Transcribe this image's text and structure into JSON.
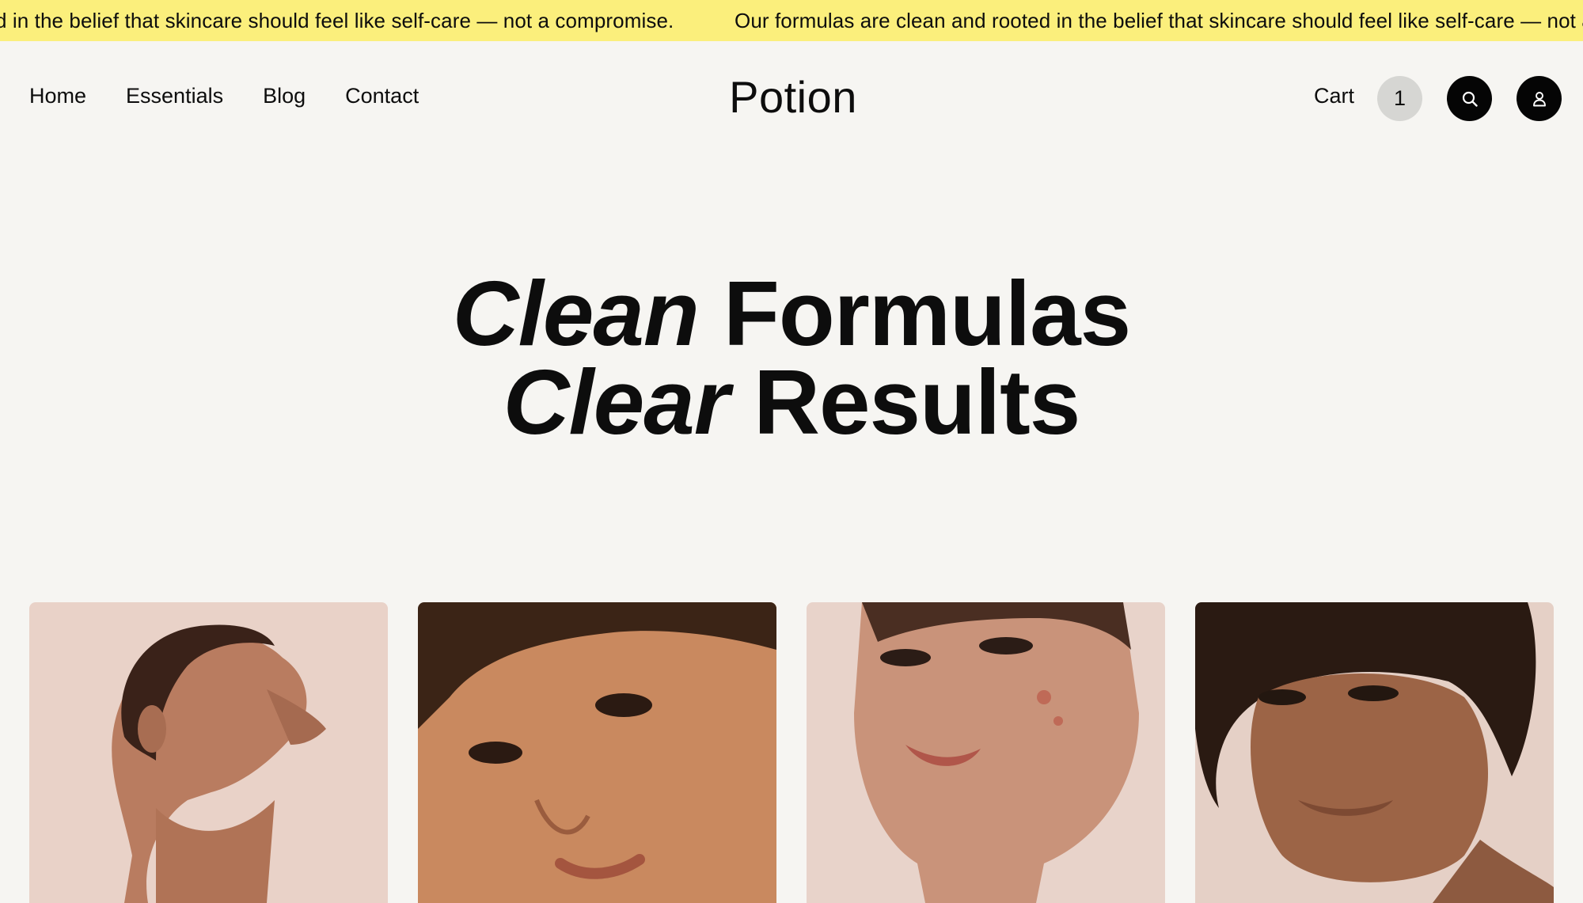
{
  "announcement": {
    "fragment_start": "d in the belief that skincare should feel like self-care — not a compromise.",
    "fragment_end": "Our formulas are clean and rooted in the belief that skincare should feel like self-care — not a c"
  },
  "nav": {
    "items": [
      {
        "label": "Home"
      },
      {
        "label": "Essentials"
      },
      {
        "label": "Blog"
      },
      {
        "label": "Contact"
      }
    ]
  },
  "brand": {
    "name": "Potion"
  },
  "actions": {
    "cart_label": "Cart",
    "cart_count": "1",
    "search_icon": "search-icon",
    "account_icon": "user-icon"
  },
  "hero": {
    "line1_italic": "Clean",
    "line1_rest": "Formulas",
    "line2_italic": "Clear",
    "line2_rest": "Results"
  },
  "gallery": {
    "images": [
      {
        "name": "portrait-woman-profile"
      },
      {
        "name": "portrait-closeup-freckles"
      },
      {
        "name": "portrait-man-acne"
      },
      {
        "name": "portrait-man-freckles"
      }
    ]
  },
  "colors": {
    "announcement_bg": "#fbef7c",
    "page_bg": "#f6f5f2",
    "button_dark": "#050505",
    "cart_badge_bg": "#d6d6d3"
  }
}
